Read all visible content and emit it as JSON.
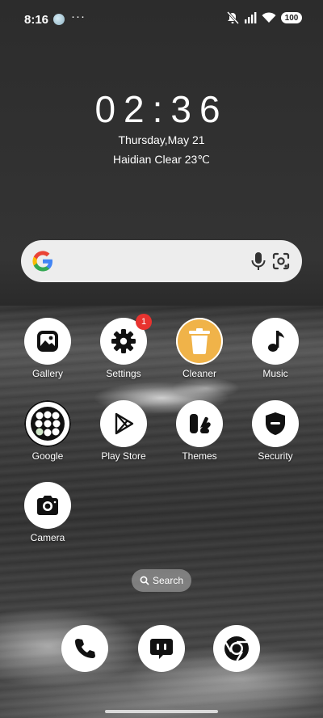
{
  "status_bar": {
    "time": "8:16",
    "more": "···",
    "battery": "100"
  },
  "clock": {
    "time": "02:36",
    "date": "Thursday,May 21",
    "weather": "Haidian Clear 23℃"
  },
  "apps": [
    {
      "name": "gallery",
      "label": "Gallery",
      "icon": "gallery-icon"
    },
    {
      "name": "settings",
      "label": "Settings",
      "icon": "gear-icon",
      "badge": "1"
    },
    {
      "name": "cleaner",
      "label": "Cleaner",
      "icon": "trash-icon"
    },
    {
      "name": "music",
      "label": "Music",
      "icon": "music-note-icon"
    },
    {
      "name": "google",
      "label": "Google",
      "icon": "google-folder-icon"
    },
    {
      "name": "play-store",
      "label": "Play Store",
      "icon": "play-icon"
    },
    {
      "name": "themes",
      "label": "Themes",
      "icon": "themes-icon"
    },
    {
      "name": "security",
      "label": "Security",
      "icon": "shield-icon"
    },
    {
      "name": "camera",
      "label": "Camera",
      "icon": "camera-icon"
    }
  ],
  "search_pill": {
    "label": "Search"
  },
  "dock": [
    {
      "name": "phone",
      "icon": "phone-icon"
    },
    {
      "name": "messages",
      "icon": "message-icon"
    },
    {
      "name": "chrome",
      "icon": "chrome-icon"
    }
  ],
  "colors": {
    "badge": "#e8332f",
    "cleaner_accent": "#f0b349",
    "search_bar_bg": "#ededed"
  }
}
